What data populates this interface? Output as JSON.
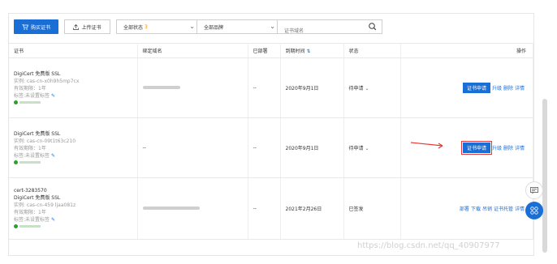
{
  "toolbar": {
    "buy_label": "购买证书",
    "upload_label": "上传证书",
    "status_select": "全部状态",
    "status_count": "3",
    "brand_select": "全部品牌",
    "search_placeholder": "证书域名"
  },
  "table": {
    "headers": [
      "证书",
      "绑定域名",
      "已部署",
      "到期时间",
      "状态",
      "操作"
    ],
    "rows": [
      {
        "cert_id": "",
        "name": "DigiCert 免费版 SSL",
        "instance": "实例: cas-cn-x0h9h5mp7cx",
        "validity": "有效期限：1年",
        "tag": "标签:未设置标签",
        "domain": "",
        "deployed": "--",
        "expire": "2020年9月1日",
        "status": "待申请",
        "actions": [
          "证书申请",
          "升级",
          "删除",
          "详情"
        ]
      },
      {
        "cert_id": "",
        "name": "DigiCert 免费版 SSL",
        "instance": "实例: cas-cn-09t1t63c210",
        "validity": "有效期限：1年",
        "tag": "标签:未设置标签",
        "domain": "--",
        "deployed": "--",
        "expire": "2020年9月1日",
        "status": "待申请",
        "actions": [
          "证书申请",
          "升级",
          "删除",
          "详情"
        ]
      },
      {
        "cert_id": "cert-3283570",
        "name": "DigiCert 免费版 SSL",
        "instance": "实例: cas-cn-459 ljaa081z",
        "validity": "有效期限：1年",
        "tag": "标签:未设置标签",
        "domain": "",
        "deployed": "--",
        "expire": "2021年2月26日",
        "status": "已签发",
        "actions": [
          "部署",
          "下载",
          "吊销",
          "证书托管",
          "详情"
        ]
      }
    ]
  },
  "watermark": "https://blog.csdn.net/qq_40907977",
  "colors": {
    "primary": "#1a6fd6",
    "accent": "#f08a00",
    "arrow": "#e53935"
  }
}
